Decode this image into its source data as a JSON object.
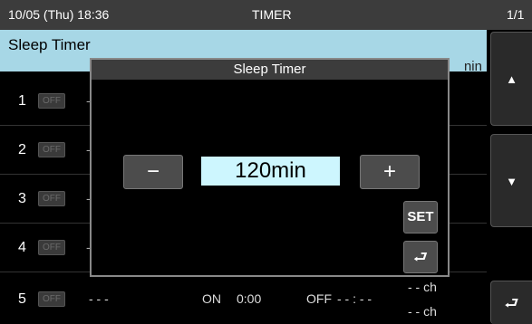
{
  "status": {
    "datetime": "10/05 (Thu)  18:36",
    "screen": "TIMER",
    "page": "1/1"
  },
  "header": {
    "title": "Sleep Timer",
    "unit_partial": "nin"
  },
  "rows": [
    {
      "num": "1",
      "state": "OFF",
      "dash": "-"
    },
    {
      "num": "2",
      "state": "OFF",
      "dash": "-"
    },
    {
      "num": "3",
      "state": "OFF",
      "dash": "-"
    },
    {
      "num": "4",
      "state": "OFF",
      "dash": "-"
    },
    {
      "num": "5",
      "state": "OFF",
      "dash": "- - -",
      "on_label": "ON",
      "on_time": "0:00",
      "off_label": "OFF",
      "off_time": "- - : - -",
      "ch_on": "- - ch",
      "ch_off": "- - ch"
    }
  ],
  "dialog": {
    "title": "Sleep Timer",
    "minus": "−",
    "value": "120min",
    "plus": "+",
    "set": "SET",
    "back": "⮐"
  },
  "sidebar": {
    "up": "▲",
    "down": "▼",
    "back": "⮐"
  },
  "colors": {
    "header_bg": "#a7d7e6",
    "value_bg": "#cdf6fe",
    "statusbar_bg": "#3c3c3c"
  }
}
